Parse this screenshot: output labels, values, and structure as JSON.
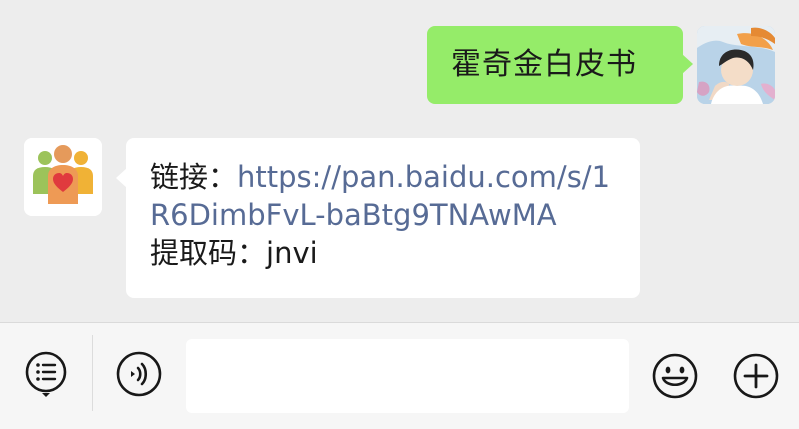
{
  "messages": {
    "outgoing": {
      "text": "霍奇金白皮书"
    },
    "incoming": {
      "link_label": "链接：",
      "link_line1": "https://pan.baidu.com/s/1",
      "link_line2": "R6DimbFvL-baBtg9TNAwMA",
      "code_label": "提取码：",
      "code_value": "jnvi"
    }
  },
  "input_bar": {
    "menu_icon": "list-menu-icon",
    "voice_icon": "voice-icon",
    "emoji_icon": "emoji-icon",
    "plus_icon": "plus-icon",
    "text_value": ""
  },
  "colors": {
    "background": "#ededed",
    "outgoing_bubble": "#95ec69",
    "incoming_bubble": "#ffffff",
    "link": "#576b95",
    "input_bar": "#f6f6f6"
  }
}
